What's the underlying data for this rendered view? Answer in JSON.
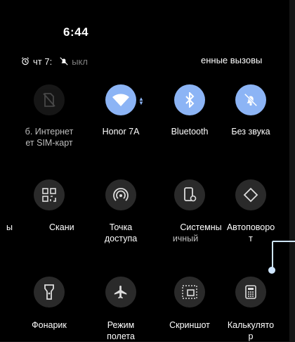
{
  "status_bar": {
    "time": "6:44",
    "alarm_text": "чт 7:",
    "mute_text": "ыкл",
    "missed_text": "енные вызовы"
  },
  "tiles_row1": [
    {
      "label_line1": "б. Интернет",
      "label_line2": "ет SIM-карт",
      "icon": "no-sim-icon",
      "active": false,
      "faded": true
    },
    {
      "label_line1": "Honor 7A",
      "label_line2": "",
      "icon": "wifi-icon",
      "active": true
    },
    {
      "label_line1": "Bluetooth",
      "label_line2": "",
      "icon": "bluetooth-icon",
      "active": true
    },
    {
      "label_line1": "Без звука",
      "label_line2": "",
      "icon": "bell-off-icon",
      "active": true
    }
  ],
  "tiles_row2": [
    {
      "label_line1": "ы",
      "label_line2": "",
      "icon": "",
      "active": false
    },
    {
      "label_line1": "Скани",
      "label_line2": "",
      "icon": "qr-scan-icon",
      "active": false
    },
    {
      "label_line1": "Точка",
      "label_line2": "доступа",
      "icon": "hotspot-icon",
      "active": false
    },
    {
      "label_line1": "Системны",
      "label_line2": "ичный",
      "icon": "system-settings-icon",
      "active": false
    },
    {
      "label_line1": "Автоповоро",
      "label_line2": "т",
      "icon": "auto-rotate-icon",
      "active": false
    }
  ],
  "tiles_row3": [
    {
      "label_line1": "Фонарик",
      "label_line2": "",
      "icon": "flashlight-icon",
      "active": false
    },
    {
      "label_line1": "Режим",
      "label_line2": "полета",
      "icon": "airplane-icon",
      "active": false
    },
    {
      "label_line1": "Скриншот",
      "label_line2": "",
      "icon": "screenshot-icon",
      "active": false
    },
    {
      "label_line1": "Калькулято",
      "label_line2": "р",
      "icon": "calculator-icon",
      "active": false
    }
  ],
  "colors": {
    "active": "#8cb4f5",
    "tile": "#2a2a2a",
    "background": "#000000"
  }
}
